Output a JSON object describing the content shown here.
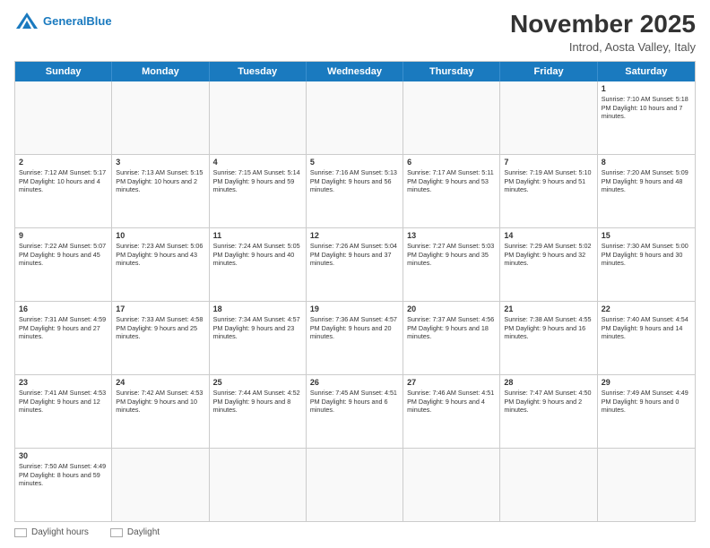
{
  "header": {
    "logo_line1": "General",
    "logo_line2": "Blue",
    "month_title": "November 2025",
    "location": "Introd, Aosta Valley, Italy"
  },
  "days_of_week": [
    "Sunday",
    "Monday",
    "Tuesday",
    "Wednesday",
    "Thursday",
    "Friday",
    "Saturday"
  ],
  "weeks": [
    [
      {
        "day": "",
        "info": ""
      },
      {
        "day": "",
        "info": ""
      },
      {
        "day": "",
        "info": ""
      },
      {
        "day": "",
        "info": ""
      },
      {
        "day": "",
        "info": ""
      },
      {
        "day": "",
        "info": ""
      },
      {
        "day": "1",
        "info": "Sunrise: 7:10 AM\nSunset: 5:18 PM\nDaylight: 10 hours\nand 7 minutes."
      }
    ],
    [
      {
        "day": "2",
        "info": "Sunrise: 7:12 AM\nSunset: 5:17 PM\nDaylight: 10 hours\nand 4 minutes."
      },
      {
        "day": "3",
        "info": "Sunrise: 7:13 AM\nSunset: 5:15 PM\nDaylight: 10 hours\nand 2 minutes."
      },
      {
        "day": "4",
        "info": "Sunrise: 7:15 AM\nSunset: 5:14 PM\nDaylight: 9 hours\nand 59 minutes."
      },
      {
        "day": "5",
        "info": "Sunrise: 7:16 AM\nSunset: 5:13 PM\nDaylight: 9 hours\nand 56 minutes."
      },
      {
        "day": "6",
        "info": "Sunrise: 7:17 AM\nSunset: 5:11 PM\nDaylight: 9 hours\nand 53 minutes."
      },
      {
        "day": "7",
        "info": "Sunrise: 7:19 AM\nSunset: 5:10 PM\nDaylight: 9 hours\nand 51 minutes."
      },
      {
        "day": "8",
        "info": "Sunrise: 7:20 AM\nSunset: 5:09 PM\nDaylight: 9 hours\nand 48 minutes."
      }
    ],
    [
      {
        "day": "9",
        "info": "Sunrise: 7:22 AM\nSunset: 5:07 PM\nDaylight: 9 hours\nand 45 minutes."
      },
      {
        "day": "10",
        "info": "Sunrise: 7:23 AM\nSunset: 5:06 PM\nDaylight: 9 hours\nand 43 minutes."
      },
      {
        "day": "11",
        "info": "Sunrise: 7:24 AM\nSunset: 5:05 PM\nDaylight: 9 hours\nand 40 minutes."
      },
      {
        "day": "12",
        "info": "Sunrise: 7:26 AM\nSunset: 5:04 PM\nDaylight: 9 hours\nand 37 minutes."
      },
      {
        "day": "13",
        "info": "Sunrise: 7:27 AM\nSunset: 5:03 PM\nDaylight: 9 hours\nand 35 minutes."
      },
      {
        "day": "14",
        "info": "Sunrise: 7:29 AM\nSunset: 5:02 PM\nDaylight: 9 hours\nand 32 minutes."
      },
      {
        "day": "15",
        "info": "Sunrise: 7:30 AM\nSunset: 5:00 PM\nDaylight: 9 hours\nand 30 minutes."
      }
    ],
    [
      {
        "day": "16",
        "info": "Sunrise: 7:31 AM\nSunset: 4:59 PM\nDaylight: 9 hours\nand 27 minutes."
      },
      {
        "day": "17",
        "info": "Sunrise: 7:33 AM\nSunset: 4:58 PM\nDaylight: 9 hours\nand 25 minutes."
      },
      {
        "day": "18",
        "info": "Sunrise: 7:34 AM\nSunset: 4:57 PM\nDaylight: 9 hours\nand 23 minutes."
      },
      {
        "day": "19",
        "info": "Sunrise: 7:36 AM\nSunset: 4:57 PM\nDaylight: 9 hours\nand 20 minutes."
      },
      {
        "day": "20",
        "info": "Sunrise: 7:37 AM\nSunset: 4:56 PM\nDaylight: 9 hours\nand 18 minutes."
      },
      {
        "day": "21",
        "info": "Sunrise: 7:38 AM\nSunset: 4:55 PM\nDaylight: 9 hours\nand 16 minutes."
      },
      {
        "day": "22",
        "info": "Sunrise: 7:40 AM\nSunset: 4:54 PM\nDaylight: 9 hours\nand 14 minutes."
      }
    ],
    [
      {
        "day": "23",
        "info": "Sunrise: 7:41 AM\nSunset: 4:53 PM\nDaylight: 9 hours\nand 12 minutes."
      },
      {
        "day": "24",
        "info": "Sunrise: 7:42 AM\nSunset: 4:53 PM\nDaylight: 9 hours\nand 10 minutes."
      },
      {
        "day": "25",
        "info": "Sunrise: 7:44 AM\nSunset: 4:52 PM\nDaylight: 9 hours\nand 8 minutes."
      },
      {
        "day": "26",
        "info": "Sunrise: 7:45 AM\nSunset: 4:51 PM\nDaylight: 9 hours\nand 6 minutes."
      },
      {
        "day": "27",
        "info": "Sunrise: 7:46 AM\nSunset: 4:51 PM\nDaylight: 9 hours\nand 4 minutes."
      },
      {
        "day": "28",
        "info": "Sunrise: 7:47 AM\nSunset: 4:50 PM\nDaylight: 9 hours\nand 2 minutes."
      },
      {
        "day": "29",
        "info": "Sunrise: 7:49 AM\nSunset: 4:49 PM\nDaylight: 9 hours\nand 0 minutes."
      }
    ],
    [
      {
        "day": "30",
        "info": "Sunrise: 7:50 AM\nSunset: 4:49 PM\nDaylight: 8 hours\nand 59 minutes."
      },
      {
        "day": "",
        "info": ""
      },
      {
        "day": "",
        "info": ""
      },
      {
        "day": "",
        "info": ""
      },
      {
        "day": "",
        "info": ""
      },
      {
        "day": "",
        "info": ""
      },
      {
        "day": "",
        "info": ""
      }
    ]
  ],
  "legend": {
    "daylight_hours_label": "Daylight hours",
    "daylight_label": "Daylight"
  }
}
